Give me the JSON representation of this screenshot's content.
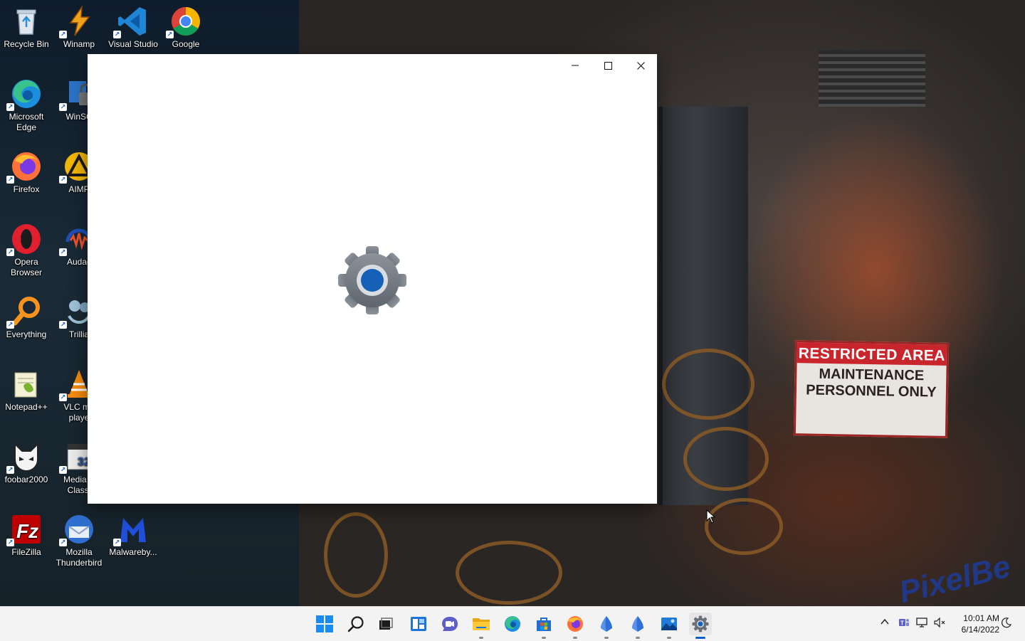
{
  "desktop": {
    "icons": [
      {
        "label": "Recycle Bin",
        "icon": "recycle-bin-icon"
      },
      {
        "label": "Winamp",
        "icon": "winamp-icon"
      },
      {
        "label": "Visual Studio",
        "icon": "vscode-icon"
      },
      {
        "label": "Google",
        "icon": "chrome-icon"
      },
      {
        "label": "Microsoft Edge",
        "icon": "edge-icon"
      },
      {
        "label": "WinSC",
        "icon": "winscp-icon"
      },
      {
        "label": "Firefox",
        "icon": "firefox-icon"
      },
      {
        "label": "AIMP",
        "icon": "aimp-icon"
      },
      {
        "label": "Opera Browser",
        "icon": "opera-icon"
      },
      {
        "label": "Audac",
        "icon": "audacity-icon"
      },
      {
        "label": "Everything",
        "icon": "everything-search-icon"
      },
      {
        "label": "Trillia",
        "icon": "trillian-icon"
      },
      {
        "label": "Notepad++",
        "icon": "notepadpp-icon"
      },
      {
        "label": "VLC me playe",
        "icon": "vlc-icon"
      },
      {
        "label": "foobar2000",
        "icon": "foobar2000-icon"
      },
      {
        "label": "Media P Classi",
        "icon": "mpc-icon"
      },
      {
        "label": "FileZilla",
        "icon": "filezilla-icon"
      },
      {
        "label": "Mozilla Thunderbird",
        "icon": "thunderbird-icon"
      },
      {
        "label": "Malwareby...",
        "icon": "malwarebytes-icon"
      }
    ]
  },
  "wallpaper": {
    "sign_top": "RESTRICTED AREA",
    "sign_bottom": "MAINTENANCE PERSONNEL ONLY",
    "watermark": "PixelBe"
  },
  "window": {
    "app_icon": "settings-gear-icon",
    "minimize_glyph": "—",
    "maximize_glyph": "☐",
    "close_glyph": "✕"
  },
  "taskbar": {
    "apps": [
      {
        "icon": "start-icon"
      },
      {
        "icon": "search-icon"
      },
      {
        "icon": "task-view-icon"
      },
      {
        "icon": "widgets-icon"
      },
      {
        "icon": "chat-icon"
      },
      {
        "icon": "file-explorer-icon"
      },
      {
        "icon": "edge-icon"
      },
      {
        "icon": "store-icon"
      },
      {
        "icon": "firefox-icon"
      },
      {
        "icon": "app-blue-1-icon"
      },
      {
        "icon": "app-blue-2-icon"
      },
      {
        "icon": "photos-icon"
      },
      {
        "icon": "settings-icon"
      }
    ],
    "tray": {
      "chevron": "^",
      "time": "10:01 AM",
      "date": "6/14/2022"
    }
  },
  "colors": {
    "accent": "#0a5fc9",
    "taskbar_bg": "#f3f3f3",
    "sign_red": "#c8262c"
  }
}
